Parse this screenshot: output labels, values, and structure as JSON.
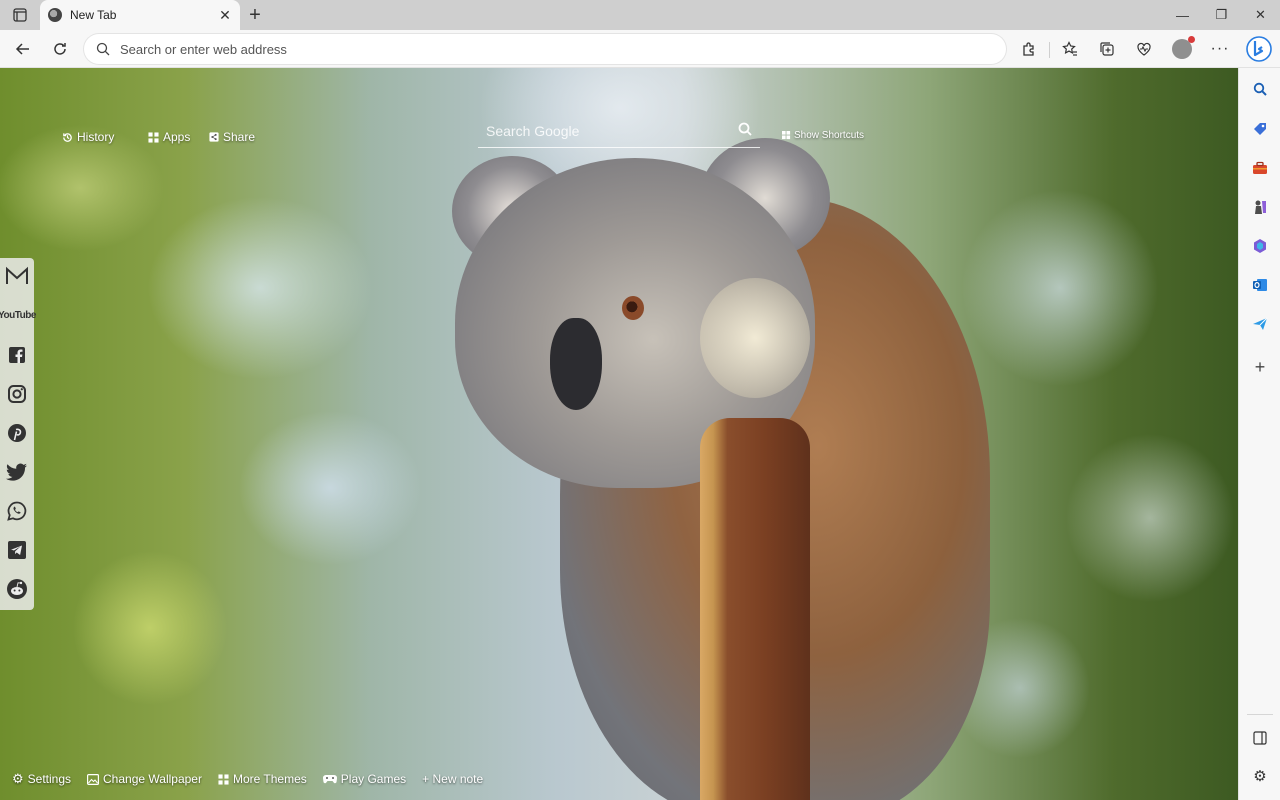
{
  "browser": {
    "tab": {
      "title": "New Tab"
    },
    "address_bar": {
      "placeholder": "Search or enter web address",
      "value": ""
    }
  },
  "newtab": {
    "top_links": [
      {
        "label": "History",
        "icon": "history-icon"
      },
      {
        "label": "Apps",
        "icon": "apps-grid-icon"
      },
      {
        "label": "Share",
        "icon": "share-icon"
      }
    ],
    "search": {
      "placeholder": "Search Google"
    },
    "show_shortcuts": "Show Shortcuts",
    "social": [
      "gmail-icon",
      "youtube-icon",
      "facebook-icon",
      "instagram-icon",
      "pinterest-icon",
      "twitter-icon",
      "whatsapp-icon",
      "telegram-icon",
      "reddit-icon"
    ],
    "youtube_label": "YouTube",
    "bottom_links": [
      {
        "label": "Settings",
        "icon": "gear-icon"
      },
      {
        "label": "Change Wallpaper",
        "icon": "image-icon"
      },
      {
        "label": "More Themes",
        "icon": "grid-icon"
      },
      {
        "label": "Play Games",
        "icon": "gamepad-icon"
      },
      {
        "label": "+ New note",
        "icon": ""
      }
    ]
  },
  "colors": {
    "accent": "#0f6cbd",
    "sidebar_bg": "#f7f7f7",
    "tabstrip_bg": "#cfcfcf"
  }
}
